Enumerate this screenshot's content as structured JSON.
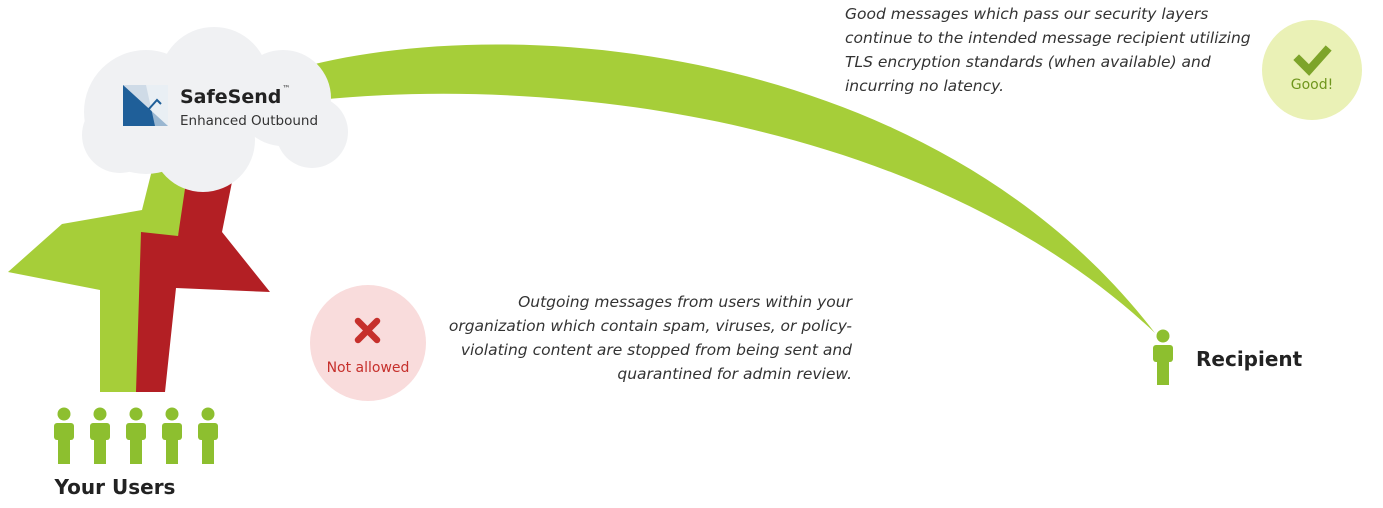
{
  "product": {
    "name": "SafeSend",
    "trademark": "™",
    "subtitle": "Enhanced Outbound"
  },
  "good": {
    "description": "Good messages which pass our security layers continue to the intended message recipient utilizing TLS encryption standards (when available) and incurring no latency.",
    "badge_label": "Good!",
    "icon": "checkmark-icon"
  },
  "bad": {
    "description": "Outgoing messages from users within your organization which contain spam, viruses, or policy-violating content are stopped from being sent and quarantined for admin review.",
    "badge_label": "Not allowed",
    "icon": "x-mark-icon"
  },
  "users": {
    "label": "Your Users",
    "count": 5,
    "icon": "person-icon"
  },
  "recipient": {
    "label": "Recipient",
    "icon": "person-icon"
  },
  "colors": {
    "green": "#a6ce39",
    "dark_green": "#8dbf2f",
    "red": "#b31f24",
    "cloud": "#f0f1f3",
    "logo_blue": "#1f5f99",
    "good_badge": "#eaf1b6",
    "bad_badge": "#f9dcdc"
  }
}
